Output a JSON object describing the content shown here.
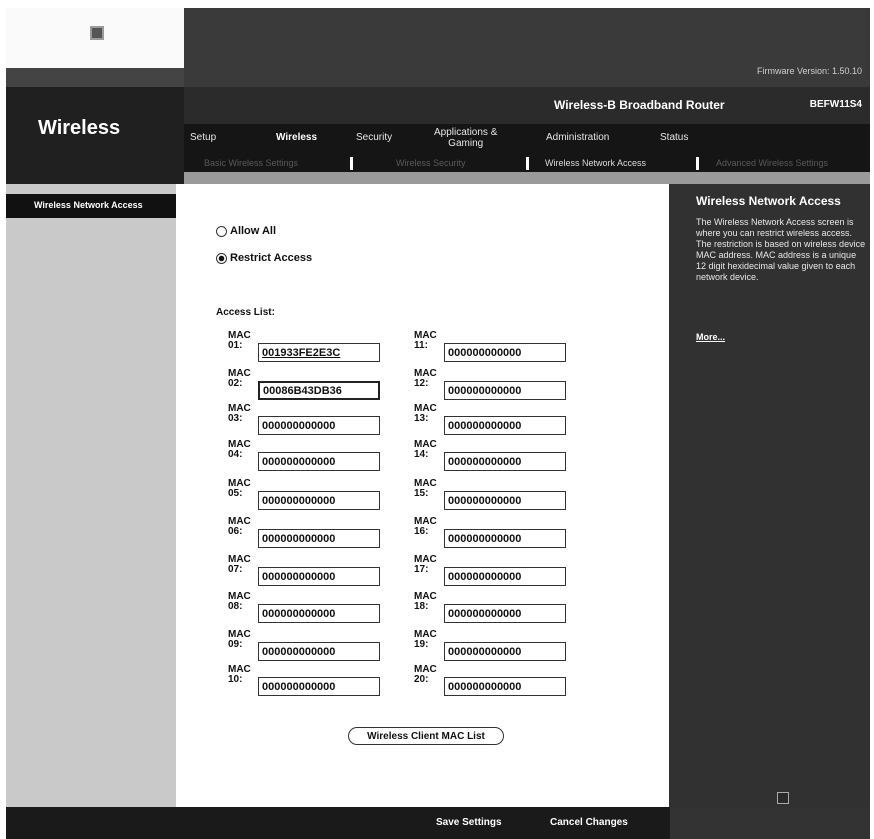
{
  "firmware": "Firmware Version: 1.50.10",
  "product_name": "Wireless-B Broadband Router",
  "model_number": "BEFW11S4",
  "section_title": "Wireless",
  "sidebar_label": "Wireless Network Access",
  "nav": [
    "Setup",
    "Wireless",
    "Security",
    "Applications &",
    "Gaming",
    "Administration",
    "Status"
  ],
  "subnav": [
    "Basic Wireless Settings",
    "Wireless Security",
    "Wireless Network Access",
    "Advanced Wireless Settings"
  ],
  "access": {
    "allow_all": "Allow All",
    "restrict": "Restrict Access",
    "selected": "restrict",
    "list_label": "Access List:"
  },
  "mac_prefix": "MAC",
  "mac_entries": [
    {
      "num": "01:",
      "value": "001933FE2E3C"
    },
    {
      "num": "02:",
      "value": "00086B43DB36"
    },
    {
      "num": "03:",
      "value": "000000000000"
    },
    {
      "num": "04:",
      "value": "000000000000"
    },
    {
      "num": "05:",
      "value": "000000000000"
    },
    {
      "num": "06:",
      "value": "000000000000"
    },
    {
      "num": "07:",
      "value": "000000000000"
    },
    {
      "num": "08:",
      "value": "000000000000"
    },
    {
      "num": "09:",
      "value": "000000000000"
    },
    {
      "num": "10:",
      "value": "000000000000"
    },
    {
      "num": "11:",
      "value": "000000000000"
    },
    {
      "num": "12:",
      "value": "000000000000"
    },
    {
      "num": "13:",
      "value": "000000000000"
    },
    {
      "num": "14:",
      "value": "000000000000"
    },
    {
      "num": "15:",
      "value": "000000000000"
    },
    {
      "num": "16:",
      "value": "000000000000"
    },
    {
      "num": "17:",
      "value": "000000000000"
    },
    {
      "num": "18:",
      "value": "000000000000"
    },
    {
      "num": "19:",
      "value": "000000000000"
    },
    {
      "num": "20:",
      "value": "000000000000"
    }
  ],
  "client_list_button": "Wireless Client MAC List",
  "help": {
    "title": "Wireless Network Access",
    "text": "The Wireless Network Access screen is where you can restrict wireless access. The restriction is based on wireless device MAC address. MAC address is a unique 12 digit hexidecimal value given to each network device.",
    "more": "More..."
  },
  "buttons": {
    "save": "Save Settings",
    "cancel": "Cancel Changes"
  }
}
